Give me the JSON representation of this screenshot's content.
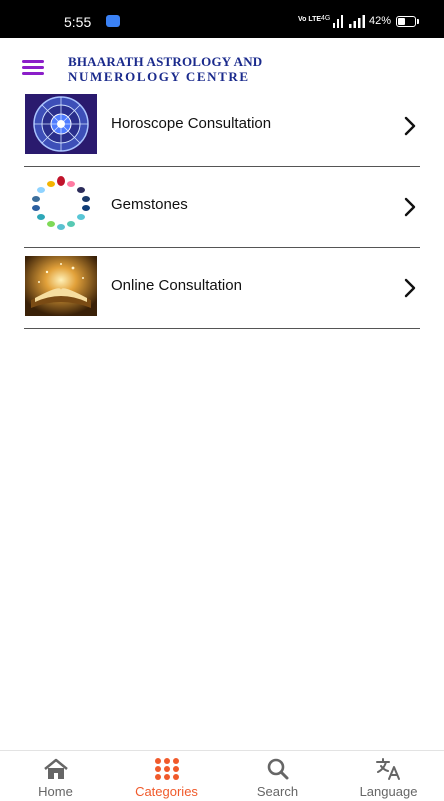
{
  "status_bar": {
    "time": "5:55",
    "network": "4G",
    "volte": "Vo LTE",
    "battery": "42%"
  },
  "header": {
    "logo_line1": "BHAARATH ASTROLOGY AND",
    "logo_line2": "NUMEROLOGY CENTRE",
    "brand_color": "#1a2a8c",
    "menu_color": "#8b1ec9"
  },
  "categories": [
    {
      "label": "Horoscope Consultation",
      "icon": "zodiac-wheel"
    },
    {
      "label": "Gemstones",
      "icon": "gemstones"
    },
    {
      "label": "Online Consultation",
      "icon": "glowing-book"
    }
  ],
  "bottom_nav": {
    "active_color": "#f05a2b",
    "items": [
      {
        "label": "Home",
        "icon": "home-icon"
      },
      {
        "label": "Categories",
        "icon": "grid-icon",
        "active": true
      },
      {
        "label": "Search",
        "icon": "search-icon"
      },
      {
        "label": "Language",
        "icon": "translate-icon"
      }
    ]
  }
}
